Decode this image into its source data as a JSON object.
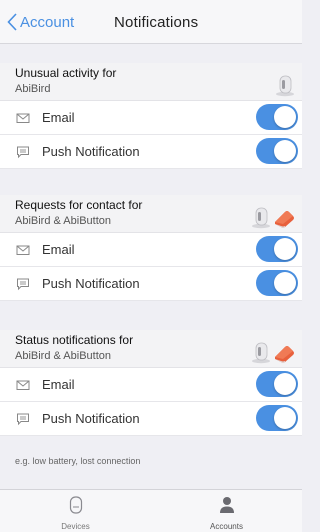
{
  "nav": {
    "back_label": "Account",
    "title": "Notifications"
  },
  "sections": [
    {
      "title": "Unusual activity for",
      "subtitle": "AbiBird",
      "devices": [
        "abibird-device-icon"
      ],
      "rows": [
        {
          "label": "Email",
          "icon": "envelope-icon",
          "enabled": true
        },
        {
          "label": "Push Notification",
          "icon": "chat-bubble-icon",
          "enabled": true
        }
      ]
    },
    {
      "title": "Requests for contact for",
      "subtitle": "AbiBird & AbiButton",
      "devices": [
        "abibird-device-icon",
        "abibutton-device-icon"
      ],
      "rows": [
        {
          "label": "Email",
          "icon": "envelope-icon",
          "enabled": true
        },
        {
          "label": "Push Notification",
          "icon": "chat-bubble-icon",
          "enabled": true
        }
      ]
    },
    {
      "title": "Status notifications for",
      "subtitle": "AbiBird & AbiButton",
      "devices": [
        "abibird-device-icon",
        "abibutton-device-icon"
      ],
      "rows": [
        {
          "label": "Email",
          "icon": "envelope-icon",
          "enabled": true
        },
        {
          "label": "Push Notification",
          "icon": "chat-bubble-icon",
          "enabled": true
        }
      ]
    }
  ],
  "note": "e.g. low battery, lost connection",
  "tabs": [
    {
      "label": "Devices",
      "icon": "device-icon",
      "active": false
    },
    {
      "label": "Accounts",
      "icon": "person-icon",
      "active": true
    }
  ],
  "colors": {
    "accent": "#4a90e2",
    "abibutton": "#e8603c",
    "background": "#efeff4"
  }
}
